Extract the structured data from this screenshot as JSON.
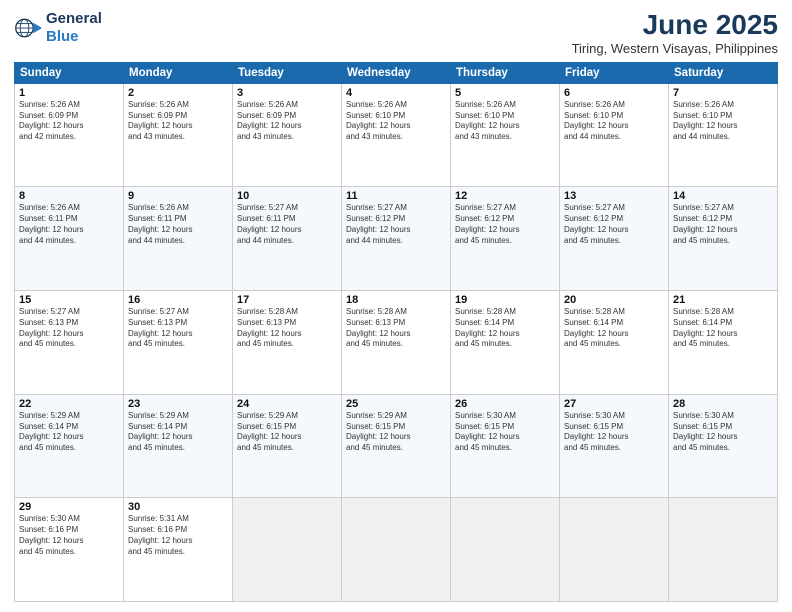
{
  "logo": {
    "line1": "General",
    "line2": "Blue"
  },
  "title": "June 2025",
  "subtitle": "Tiring, Western Visayas, Philippines",
  "header_days": [
    "Sunday",
    "Monday",
    "Tuesday",
    "Wednesday",
    "Thursday",
    "Friday",
    "Saturday"
  ],
  "weeks": [
    [
      {
        "day": "1",
        "info": "Sunrise: 5:26 AM\nSunset: 6:09 PM\nDaylight: 12 hours\nand 42 minutes."
      },
      {
        "day": "2",
        "info": "Sunrise: 5:26 AM\nSunset: 6:09 PM\nDaylight: 12 hours\nand 43 minutes."
      },
      {
        "day": "3",
        "info": "Sunrise: 5:26 AM\nSunset: 6:09 PM\nDaylight: 12 hours\nand 43 minutes."
      },
      {
        "day": "4",
        "info": "Sunrise: 5:26 AM\nSunset: 6:10 PM\nDaylight: 12 hours\nand 43 minutes."
      },
      {
        "day": "5",
        "info": "Sunrise: 5:26 AM\nSunset: 6:10 PM\nDaylight: 12 hours\nand 43 minutes."
      },
      {
        "day": "6",
        "info": "Sunrise: 5:26 AM\nSunset: 6:10 PM\nDaylight: 12 hours\nand 44 minutes."
      },
      {
        "day": "7",
        "info": "Sunrise: 5:26 AM\nSunset: 6:10 PM\nDaylight: 12 hours\nand 44 minutes."
      }
    ],
    [
      {
        "day": "8",
        "info": "Sunrise: 5:26 AM\nSunset: 6:11 PM\nDaylight: 12 hours\nand 44 minutes."
      },
      {
        "day": "9",
        "info": "Sunrise: 5:26 AM\nSunset: 6:11 PM\nDaylight: 12 hours\nand 44 minutes."
      },
      {
        "day": "10",
        "info": "Sunrise: 5:27 AM\nSunset: 6:11 PM\nDaylight: 12 hours\nand 44 minutes."
      },
      {
        "day": "11",
        "info": "Sunrise: 5:27 AM\nSunset: 6:12 PM\nDaylight: 12 hours\nand 44 minutes."
      },
      {
        "day": "12",
        "info": "Sunrise: 5:27 AM\nSunset: 6:12 PM\nDaylight: 12 hours\nand 45 minutes."
      },
      {
        "day": "13",
        "info": "Sunrise: 5:27 AM\nSunset: 6:12 PM\nDaylight: 12 hours\nand 45 minutes."
      },
      {
        "day": "14",
        "info": "Sunrise: 5:27 AM\nSunset: 6:12 PM\nDaylight: 12 hours\nand 45 minutes."
      }
    ],
    [
      {
        "day": "15",
        "info": "Sunrise: 5:27 AM\nSunset: 6:13 PM\nDaylight: 12 hours\nand 45 minutes."
      },
      {
        "day": "16",
        "info": "Sunrise: 5:27 AM\nSunset: 6:13 PM\nDaylight: 12 hours\nand 45 minutes."
      },
      {
        "day": "17",
        "info": "Sunrise: 5:28 AM\nSunset: 6:13 PM\nDaylight: 12 hours\nand 45 minutes."
      },
      {
        "day": "18",
        "info": "Sunrise: 5:28 AM\nSunset: 6:13 PM\nDaylight: 12 hours\nand 45 minutes."
      },
      {
        "day": "19",
        "info": "Sunrise: 5:28 AM\nSunset: 6:14 PM\nDaylight: 12 hours\nand 45 minutes."
      },
      {
        "day": "20",
        "info": "Sunrise: 5:28 AM\nSunset: 6:14 PM\nDaylight: 12 hours\nand 45 minutes."
      },
      {
        "day": "21",
        "info": "Sunrise: 5:28 AM\nSunset: 6:14 PM\nDaylight: 12 hours\nand 45 minutes."
      }
    ],
    [
      {
        "day": "22",
        "info": "Sunrise: 5:29 AM\nSunset: 6:14 PM\nDaylight: 12 hours\nand 45 minutes."
      },
      {
        "day": "23",
        "info": "Sunrise: 5:29 AM\nSunset: 6:14 PM\nDaylight: 12 hours\nand 45 minutes."
      },
      {
        "day": "24",
        "info": "Sunrise: 5:29 AM\nSunset: 6:15 PM\nDaylight: 12 hours\nand 45 minutes."
      },
      {
        "day": "25",
        "info": "Sunrise: 5:29 AM\nSunset: 6:15 PM\nDaylight: 12 hours\nand 45 minutes."
      },
      {
        "day": "26",
        "info": "Sunrise: 5:30 AM\nSunset: 6:15 PM\nDaylight: 12 hours\nand 45 minutes."
      },
      {
        "day": "27",
        "info": "Sunrise: 5:30 AM\nSunset: 6:15 PM\nDaylight: 12 hours\nand 45 minutes."
      },
      {
        "day": "28",
        "info": "Sunrise: 5:30 AM\nSunset: 6:15 PM\nDaylight: 12 hours\nand 45 minutes."
      }
    ],
    [
      {
        "day": "29",
        "info": "Sunrise: 5:30 AM\nSunset: 6:16 PM\nDaylight: 12 hours\nand 45 minutes."
      },
      {
        "day": "30",
        "info": "Sunrise: 5:31 AM\nSunset: 6:16 PM\nDaylight: 12 hours\nand 45 minutes."
      },
      {
        "day": "",
        "info": ""
      },
      {
        "day": "",
        "info": ""
      },
      {
        "day": "",
        "info": ""
      },
      {
        "day": "",
        "info": ""
      },
      {
        "day": "",
        "info": ""
      }
    ]
  ]
}
